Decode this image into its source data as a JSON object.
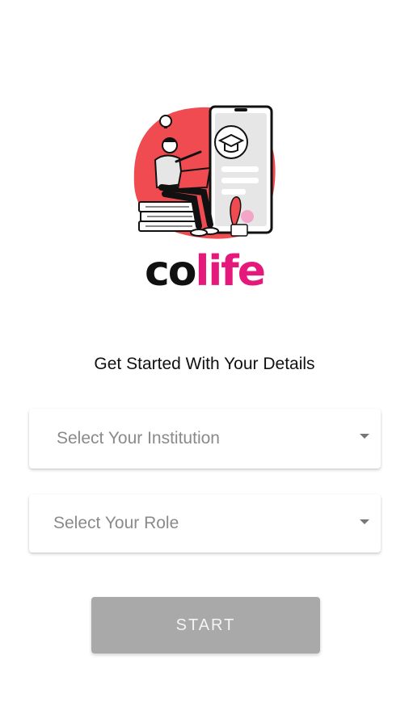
{
  "brand": {
    "logo_prefix": "co",
    "logo_suffix": "life",
    "prefix_color": "#111111",
    "suffix_color": "#e5197c"
  },
  "hero": {
    "illustration": "student-with-laptop-and-phone-graduation-cap-illustration",
    "accent_color": "#ef4b50"
  },
  "form": {
    "heading": "Get Started With Your Details",
    "institution_select": {
      "placeholder": "Select Your Institution",
      "icon": "chevron-down-icon"
    },
    "role_select": {
      "placeholder": "Select Your Role",
      "icon": "chevron-down-icon"
    },
    "start_button": {
      "label": "START",
      "color": "#a9a9a9"
    }
  }
}
